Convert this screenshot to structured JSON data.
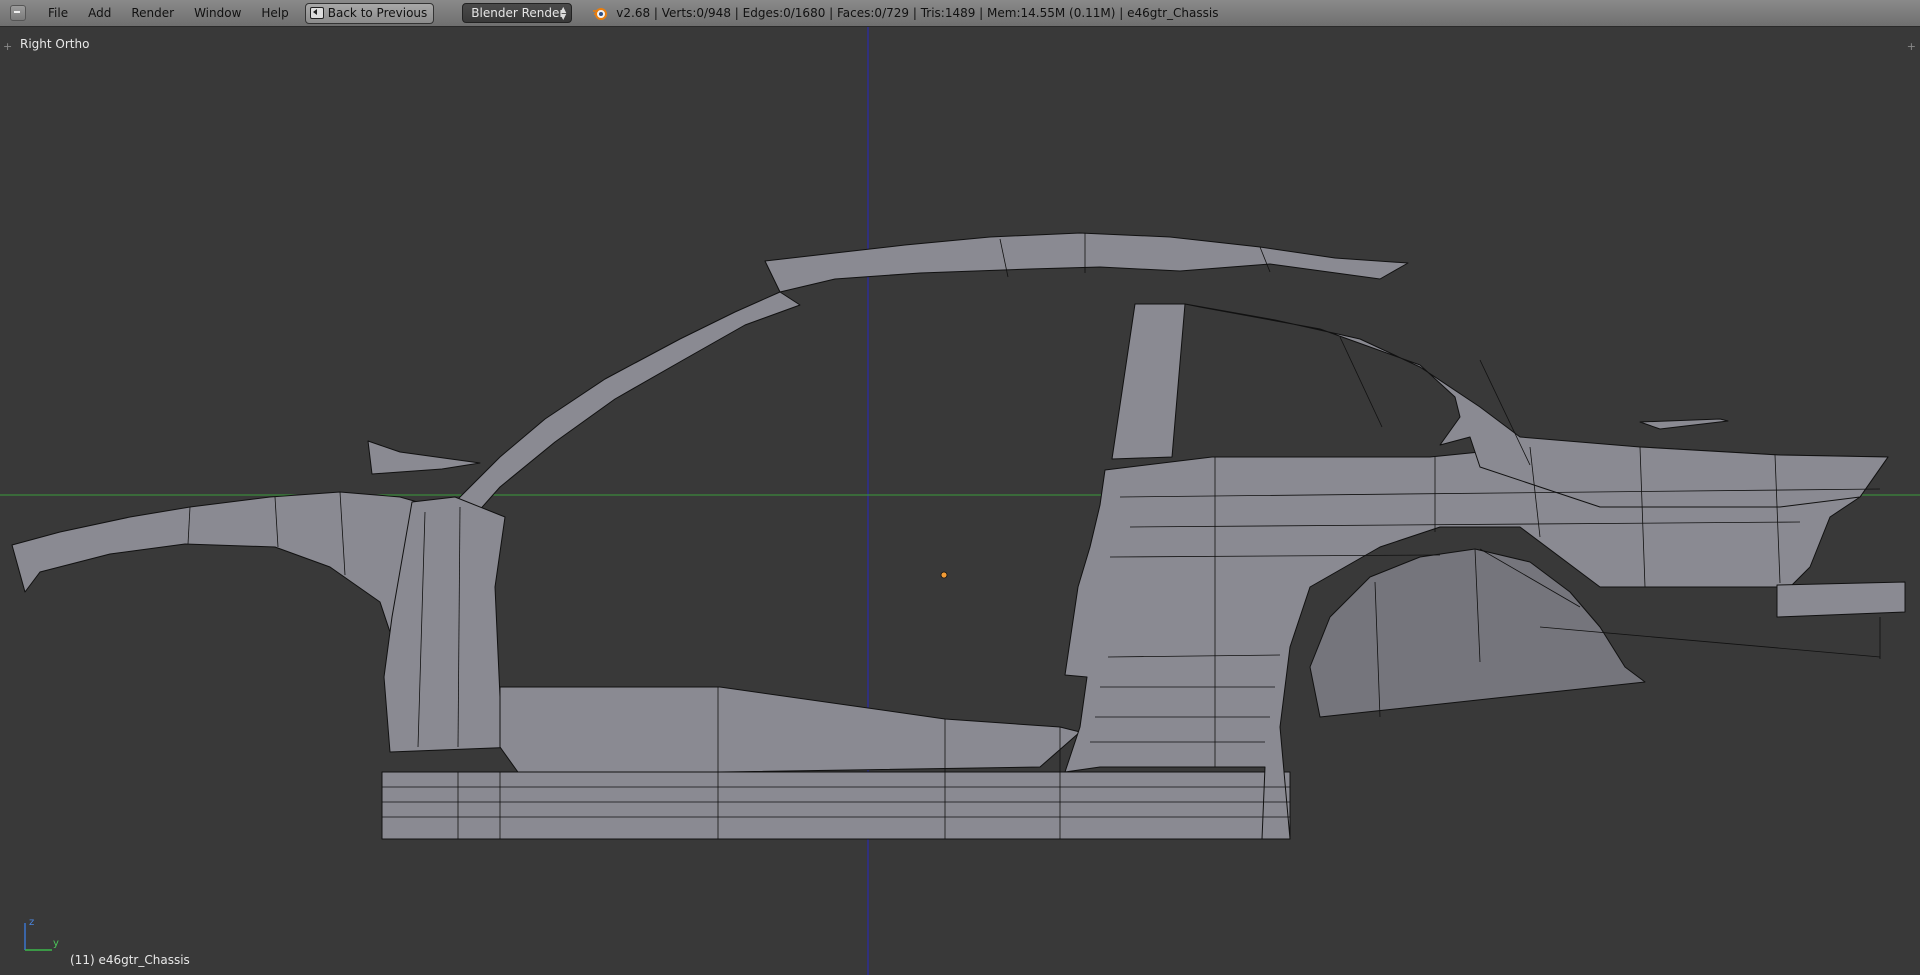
{
  "menu": {
    "file": "File",
    "add": "Add",
    "render": "Render",
    "window": "Window",
    "help": "Help"
  },
  "toolbar": {
    "back_label": "Back to Previous",
    "render_engine": "Blender Render",
    "stats": "v2.68 | Verts:0/948 | Edges:0/1680 | Faces:0/729 | Tris:1489 | Mem:14.55M (0.11M) | e46gtr_Chassis"
  },
  "viewport": {
    "view_name": "Right Ortho",
    "object_label": "(11) e46gtr_Chassis",
    "axis_z": "z",
    "axis_y": "y"
  },
  "colors": {
    "background": "#393939",
    "header": "#727272",
    "mesh_fill": "#8c8c96",
    "wire": "#000000",
    "y_axis_line": "#2a2aa8",
    "horizon_line": "#3c9a3c",
    "origin": "#f29b35"
  }
}
